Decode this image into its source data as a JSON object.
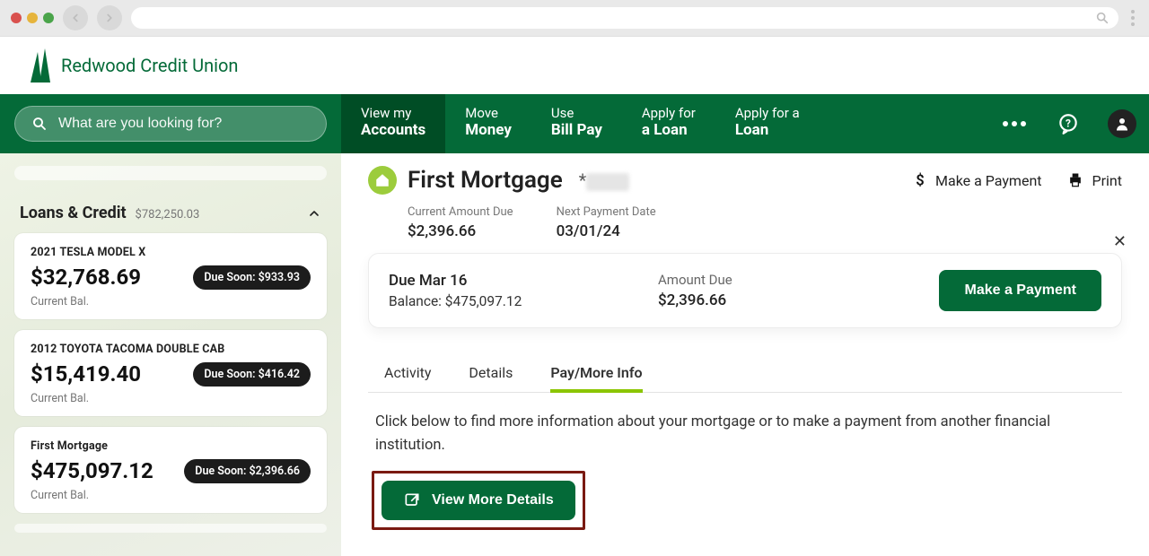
{
  "logo_text": "Redwood Credit Union",
  "search": {
    "placeholder": "What are you looking for?"
  },
  "nav": {
    "items": [
      {
        "line1": "View my",
        "line2": "Accounts"
      },
      {
        "line1": "Move",
        "line2": "Money"
      },
      {
        "line1": "Use",
        "line2": "Bill Pay"
      },
      {
        "line1": "Apply for",
        "line2": "a Loan"
      },
      {
        "line1": "Apply for a",
        "line2": "Loan"
      }
    ]
  },
  "sidebar": {
    "section_title": "Loans & Credit",
    "section_total": "$782,250.03",
    "current_bal_label": "Current Bal.",
    "loans": [
      {
        "title": "2021 TESLA MODEL X",
        "amount": "$32,768.69",
        "pill": "Due Soon: $933.93"
      },
      {
        "title": "2012 TOYOTA TACOMA DOUBLE CAB",
        "amount": "$15,419.40",
        "pill": "Due Soon: $416.42"
      },
      {
        "title": "First Mortgage",
        "amount": "$475,097.12",
        "pill": "Due Soon: $2,396.66"
      }
    ]
  },
  "account": {
    "title": "First Mortgage",
    "mask_prefix": "*",
    "actions": {
      "make_payment": "Make a Payment",
      "print": "Print"
    },
    "kv": {
      "current_due_label": "Current Amount Due",
      "current_due_value": "$2,396.66",
      "next_date_label": "Next Payment Date",
      "next_date_value": "03/01/24"
    },
    "due_card": {
      "due_line": "Due Mar 16",
      "balance_line": "Balance: $475,097.12",
      "amount_due_label": "Amount Due",
      "amount_due_value": "$2,396.66",
      "button": "Make a Payment"
    },
    "tabs": {
      "activity": "Activity",
      "details": "Details",
      "pay": "Pay/More Info"
    },
    "pay_text": "Click below to find more information about your mortgage or to make a payment from another financial institution.",
    "vmd_button": "View More Details"
  }
}
